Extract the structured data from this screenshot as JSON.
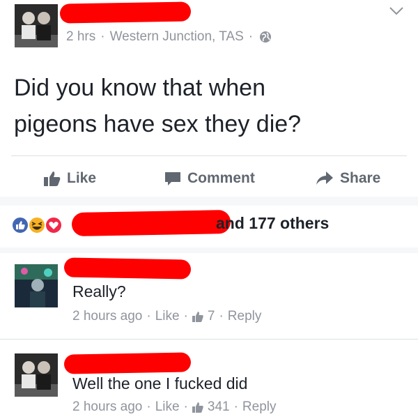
{
  "post": {
    "time": "2 hrs",
    "separator": "·",
    "location": "Western Junction, TAS",
    "privacy_icon": "globe-icon",
    "text_line1": "Did you know that when",
    "text_line2": "pigeons have sex they die?"
  },
  "actions": {
    "like": "Like",
    "comment": "Comment",
    "share": "Share"
  },
  "reactions": {
    "summary": "and 177 others",
    "icons": [
      "like-reaction-icon",
      "haha-reaction-icon",
      "love-reaction-icon"
    ]
  },
  "comments": [
    {
      "text": "Really?",
      "time": "2 hours ago",
      "like_label": "Like",
      "like_count": "7",
      "reply_label": "Reply"
    },
    {
      "text": "Well the one I fucked did",
      "time": "2 hours ago",
      "like_label": "Like",
      "like_count": "341",
      "reply_label": "Reply"
    }
  ],
  "colors": {
    "redaction": "#ff0000",
    "meta_text": "#90949c",
    "like_blue": "#4267b2",
    "background_band": "#f6f7f9"
  }
}
